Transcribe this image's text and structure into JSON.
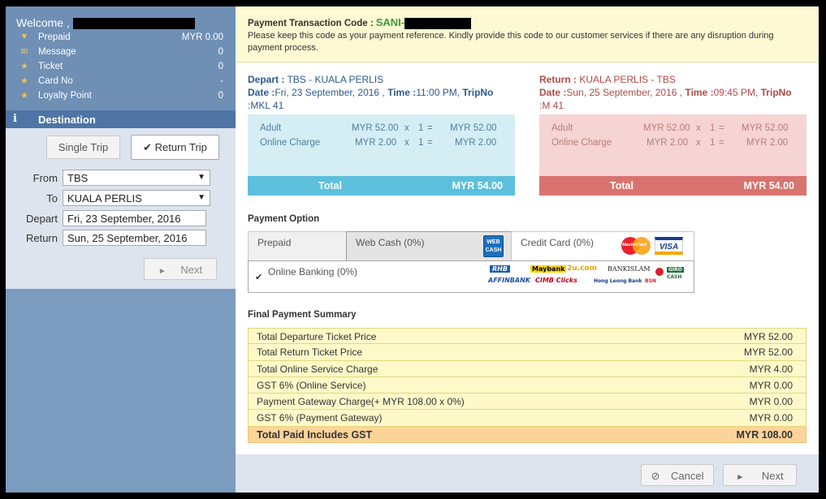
{
  "sidebar": {
    "welcome": "Welcome ,",
    "stats": [
      {
        "icon": "heart-icon",
        "glyph": "♥",
        "label": "Prepaid",
        "value": "MYR 0.00"
      },
      {
        "icon": "envelope-icon",
        "glyph": "✉",
        "label": "Message",
        "value": "0"
      },
      {
        "icon": "star-icon",
        "glyph": "★",
        "label": "Ticket",
        "value": "0"
      },
      {
        "icon": "star-icon",
        "glyph": "★",
        "label": "Card No",
        "value": "-"
      },
      {
        "icon": "star-icon",
        "glyph": "★",
        "label": "Loyalty Point",
        "value": "0"
      }
    ],
    "destination": {
      "icon_glyph": "i",
      "title": "Destination",
      "single_trip": "Single Trip",
      "return_trip": "Return Trip",
      "check_glyph": "✔",
      "from_label": "From",
      "from_value": "TBS",
      "to_label": "To",
      "to_value": "KUALA PERLIS",
      "depart_label": "Depart",
      "depart_value": "Fri, 23 September, 2016",
      "return_label": "Return",
      "return_value": "Sun, 25 September, 2016",
      "next": "Next",
      "next_glyph": "►",
      "arrow_glyph": "▼"
    }
  },
  "notice": {
    "label": "Payment Transaction Code :",
    "code": "SANI-",
    "text": "Please keep this code as your payment reference. Kindly provide this code to our customer services if there are any disruption during payment process."
  },
  "depart": {
    "label": "Depart :",
    "route": "TBS - KUALA PERLIS",
    "date_label": "Date :",
    "date": "Fri, 23 September, 2016 ,",
    "time_label": "Time :",
    "time": "11:00 PM,",
    "tripno_label": "TripNo",
    "tripno": ":MKL 41",
    "rows": [
      {
        "label": "Adult",
        "price": "MYR 52.00",
        "x": "x",
        "qty": "1",
        "eq": "=",
        "total": "MYR 52.00"
      },
      {
        "label": "Online Charge",
        "price": "MYR 2.00",
        "x": "x",
        "qty": "1",
        "eq": "=",
        "total": "MYR 2.00"
      }
    ],
    "total_label": "Total",
    "total": "MYR 54.00",
    "colors": {
      "bg": "#d4eef4",
      "total": "#5cc0dd"
    }
  },
  "return": {
    "label": "Return :",
    "route": "KUALA PERLIS - TBS",
    "date_label": "Date :",
    "date": "Sun, 25 September, 2016 ,",
    "time_label": "Time :",
    "time": "09:45 PM,",
    "tripno_label": "TripNo",
    "tripno": ":M 41",
    "rows": [
      {
        "label": "Adult",
        "price": "MYR 52.00",
        "x": "x",
        "qty": "1",
        "eq": "=",
        "total": "MYR 52.00"
      },
      {
        "label": "Online Charge",
        "price": "MYR 2.00",
        "x": "x",
        "qty": "1",
        "eq": "=",
        "total": "MYR 2.00"
      }
    ],
    "total_label": "Total",
    "total": "MYR 54.00",
    "colors": {
      "bg": "#f6d4d3",
      "total": "#d9736f"
    }
  },
  "payment_option": {
    "title": "Payment Option",
    "tabs": [
      "Prepaid",
      "Web Cash (0%)",
      "Credit Card (0%)"
    ],
    "webcash_logo": [
      "WEB",
      "CASH"
    ],
    "card_logos": [
      "MasterCard",
      "VISA"
    ],
    "online_banking": "Online Banking (0%)",
    "check_glyph": "✔",
    "bank_logos": [
      "RHB",
      "Maybank",
      "2u.com",
      "BANKISLAM",
      "AFFINBANK",
      "CIMB Clicks",
      "Hong Leong Bank",
      "BSN",
      "GIRO",
      "CASH"
    ]
  },
  "summary": {
    "title": "Final Payment Summary",
    "rows": [
      {
        "label": "Total Departure Ticket Price",
        "value": "MYR 52.00"
      },
      {
        "label": "Total Return Ticket Price",
        "value": "MYR 52.00"
      },
      {
        "label": "Total Online Service Charge",
        "value": "MYR 4.00"
      },
      {
        "label": "GST 6% (Online Service)",
        "value": "MYR 0.00"
      },
      {
        "label": "Payment Gateway Charge(+ MYR 108.00 x 0%)",
        "value": "MYR 0.00"
      },
      {
        "label": "GST 6% (Payment Gateway)",
        "value": "MYR 0.00"
      }
    ],
    "total_label": "Total Paid Includes GST",
    "total_value": "MYR 108.00"
  },
  "footer": {
    "cancel": "Cancel",
    "cancel_glyph": "⊘",
    "next": "Next",
    "next_glyph": "►"
  }
}
